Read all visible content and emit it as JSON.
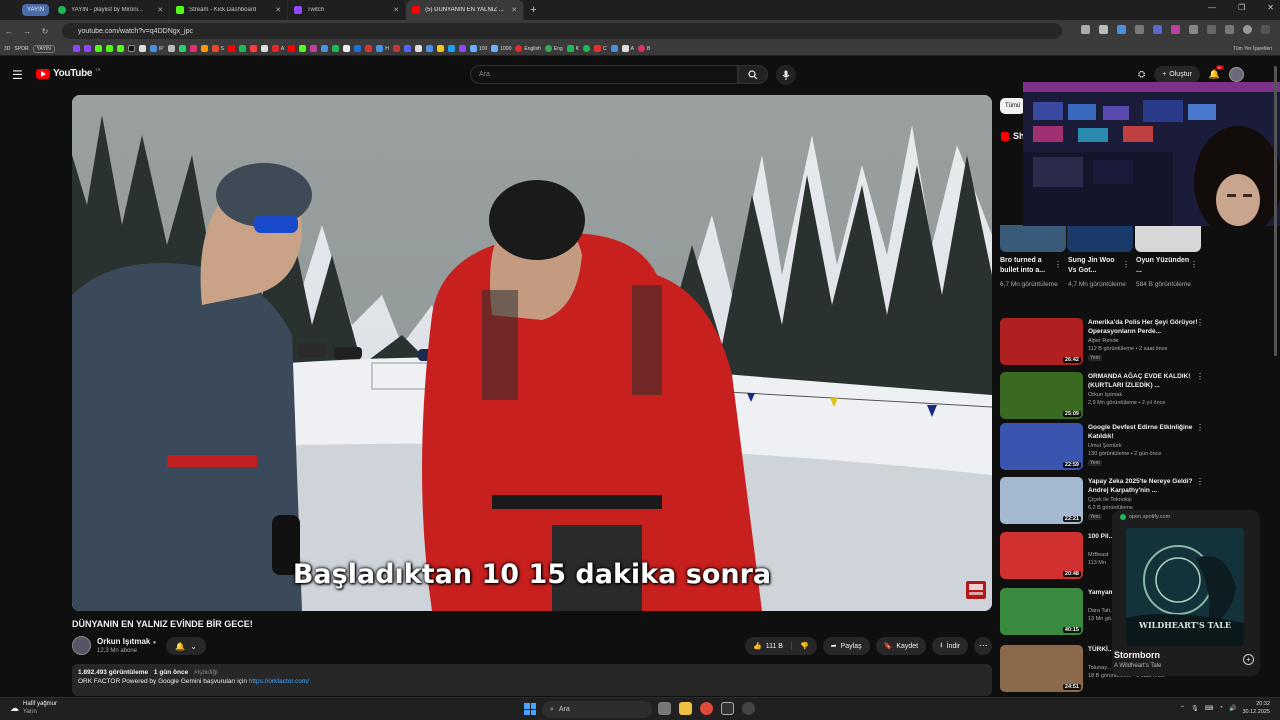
{
  "browser": {
    "tab_group_label": "YAYIN",
    "tabs": [
      {
        "title": "YAYIN - playlist by Mironi...",
        "color": "#1db954"
      },
      {
        "title": "Stream - Kick Dashboard",
        "color": "#53fc18"
      },
      {
        "title": "Twitch",
        "color": "#9146ff"
      },
      {
        "title": "(5) DÜNYANIN EN YALNIZ ...",
        "color": "#ff0000",
        "active": true
      }
    ],
    "url": "youtube.com/watch?v=q4DDNgx_jpc",
    "bookmarks_prefix": [
      "3D",
      "SPOR",
      "YAYIN"
    ],
    "bookmarks": [
      "IP",
      "S",
      "A",
      "H",
      "100",
      "1000",
      "English",
      "Eng",
      "K",
      "C",
      "A",
      "B"
    ],
    "bookmarks_right": "Tüm Yer İşaretleri"
  },
  "youtube": {
    "logo_text": "YouTube",
    "logo_country": "TR",
    "search_placeholder": "Ara",
    "create_label": "Oluştur",
    "notif_count": "9+"
  },
  "video": {
    "caption": "Başladıktan 10 15 dakika sonra",
    "title": "DÜNYANIN EN YALNIZ EVİNDE BİR GECE!",
    "channel": "Orkun Işıtmak",
    "subscribers": "12,3 Mn abone",
    "likes": "111 B",
    "share": "Paylaş",
    "save": "Kaydet",
    "download": "İndir",
    "views": "1.892.493 görüntüleme",
    "age": "1 gün önce",
    "tag": "#işbirliği",
    "desc_line": "ORK FACTOR Powered by Google Gemini başvuruları için",
    "desc_link": "https://orkfactor.com/"
  },
  "sidebar": {
    "chip": "Tümü",
    "shorts_label": "Shorts",
    "shorts": [
      {
        "title": "Bro turned a bullet into a...",
        "views": "6,7 Mn görüntüleme"
      },
      {
        "title": "Sung Jin Woo Vs Got...",
        "views": "4,7 Mn görüntüleme"
      },
      {
        "title": "Oyun Yüzünden ...",
        "views": "584 B görüntüleme"
      }
    ],
    "recs": [
      {
        "title": "Amerika'da Polis Her Şeyi Görüyor! Operasyonların Perde...",
        "channel": "Alper Rende",
        "meta": "112 B görüntüleme • 2 saat önce",
        "duration": "26:42",
        "new": "Yeni",
        "thumb": "#b02020"
      },
      {
        "title": "ORMANDA AĞAÇ EVDE KALDIK! (KURTLARI İZLEDİK) ...",
        "channel": "Orkun Işıtmak",
        "meta": "2,9 Mn görüntüleme • 2 yıl önce",
        "duration": "25:09",
        "new": "",
        "thumb": "#3a6a22"
      },
      {
        "title": "Google Devfest Edirne Etkinliğine Katıldık!",
        "channel": "Umut Şentürk",
        "meta": "130 görüntüleme • 2 gün önce",
        "duration": "22:59",
        "new": "Yeni",
        "thumb": "#3a55b0"
      },
      {
        "title": "Yapay Zeka 2025'te Nereye Geldi? Andrej Karpathy'nin ...",
        "channel": "Çiçek ile Teknoloji",
        "meta": "6,2 B görüntüleme",
        "duration": "22:21",
        "new": "Yeni",
        "thumb": "#a4b8d0"
      },
      {
        "title": "100 Pil... Ediyor",
        "channel": "MrBeast",
        "meta": "113 Mn",
        "duration": "20:48",
        "new": "",
        "thumb": "#d03030"
      },
      {
        "title": "Yamyam... Hayatta...",
        "channel": "Dara Tah...",
        "meta": "13 Mn gö...",
        "duration": "40:15",
        "new": "",
        "thumb": "#3a8a40"
      },
      {
        "title": "TÜRKİ... RÜMEL...",
        "channel": "Tolunay...",
        "meta": "18 B görüntüleme • 3 saat önce",
        "duration": "24:51",
        "new": "",
        "thumb": "#8a6a4a"
      }
    ]
  },
  "pip": {
    "source": "open.spotify.com",
    "song": "Stormborn",
    "artist": "A Wildheart's Tale",
    "album_text": "WILDHEART'S TALE"
  },
  "taskbar": {
    "weather": "Hafif yağmur",
    "weather_sub": "Yarın",
    "search": "Ara",
    "time": "20:32",
    "date": "30.12.2025"
  }
}
